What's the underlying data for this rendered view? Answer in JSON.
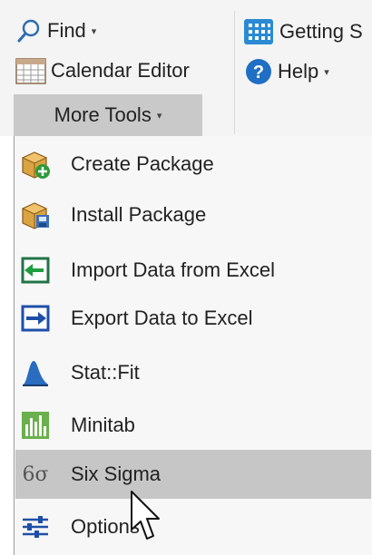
{
  "ribbon": {
    "find_label": "Find",
    "calendar_label": "Calendar Editor",
    "more_tools_label": "More Tools",
    "getting_started_label": "Getting S",
    "help_label": "Help",
    "icons": {
      "find": "search-icon",
      "calendar": "calendar-icon",
      "getting_started": "grid-icon",
      "help": "help-icon"
    }
  },
  "menu": {
    "hovered_item": "Six Sigma",
    "items": [
      {
        "label": "Create Package",
        "icon": "package-add-icon"
      },
      {
        "label": "Install Package",
        "icon": "package-install-icon"
      },
      {
        "label": "Import Data from Excel",
        "icon": "excel-import-icon"
      },
      {
        "label": "Export Data to Excel",
        "icon": "excel-export-icon"
      },
      {
        "label": "Stat::Fit",
        "icon": "distribution-icon"
      },
      {
        "label": "Minitab",
        "icon": "bar-chart-icon"
      },
      {
        "label": "Six Sigma",
        "icon": "six-sigma-icon",
        "icon_text": "6σ"
      },
      {
        "label": "Options",
        "icon": "sliders-icon"
      }
    ]
  },
  "colors": {
    "ribbon_bg": "#f4f4f4",
    "active_button": "#c9c9c9",
    "menu_bg": "#f7f7f7",
    "hover": "#c6c6c6",
    "accent_blue": "#1f6fc5",
    "excel_green": "#217346"
  }
}
